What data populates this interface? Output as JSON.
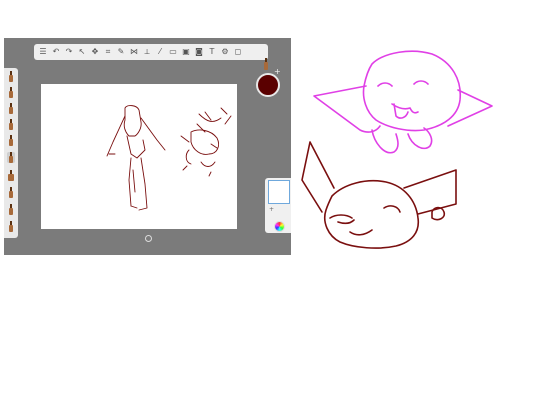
{
  "app": {
    "toolbar_icons": [
      "list-icon",
      "undo-icon",
      "redo-icon",
      "pointer-icon",
      "transform-icon",
      "crop-icon",
      "pen-icon",
      "symmetry-icon",
      "perspective-icon",
      "ruler-icon",
      "shape-icon",
      "image-icon",
      "camera-icon",
      "text-icon",
      "gear-icon",
      "frame-icon"
    ],
    "brush_count": 10,
    "selected_brush_index": 6,
    "current_color": "#5a0000",
    "canvas_background": "#ffffff",
    "frame_color": "#7b7b7b"
  },
  "doodles": {
    "pink_stroke": "#e040e6",
    "red_stroke": "#7a0f0f"
  }
}
